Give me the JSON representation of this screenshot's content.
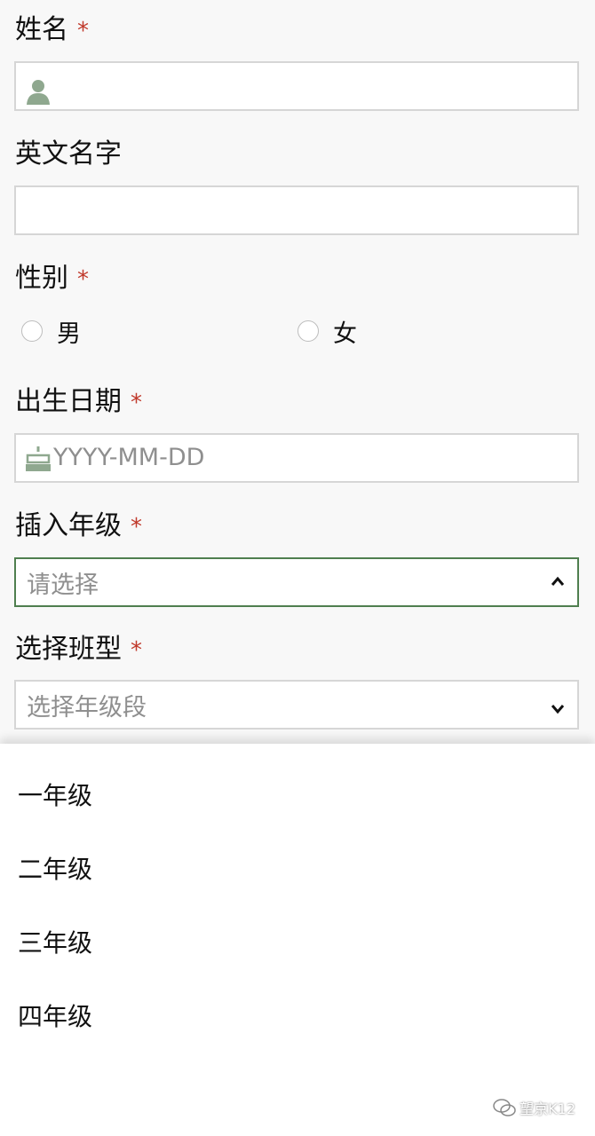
{
  "form": {
    "name": {
      "label": "姓名",
      "required_mark": "*",
      "value": ""
    },
    "english_name": {
      "label": "英文名字",
      "value": ""
    },
    "gender": {
      "label": "性别",
      "required_mark": "*",
      "options": [
        "男",
        "女"
      ]
    },
    "birthdate": {
      "label": "出生日期",
      "required_mark": "*",
      "placeholder": "YYYY-MM-DD"
    },
    "grade": {
      "label": "插入年级",
      "required_mark": "*",
      "placeholder": "请选择"
    },
    "class_type": {
      "label": "选择班型",
      "required_mark": "*",
      "placeholder": "选择年级段"
    }
  },
  "dropdown": {
    "options": [
      "一年级",
      "二年级",
      "三年级",
      "四年级"
    ]
  },
  "watermark": {
    "text": "望京K12"
  },
  "colors": {
    "accent": "#4f7f4f",
    "required": "#c0392b",
    "icon": "#8fa88f"
  },
  "icons": {
    "name_field": "person-icon",
    "birthdate_field": "birthday-cake-icon",
    "grade_select": "chevron-up-icon",
    "class_select": "chevron-down-icon",
    "watermark": "wechat-icon"
  }
}
